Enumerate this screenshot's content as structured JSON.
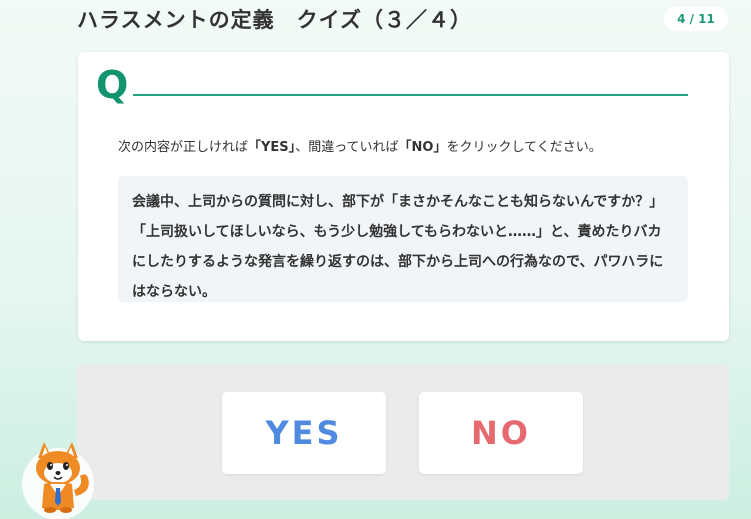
{
  "header": {
    "title": "ハラスメントの定義　クイズ（３／４）",
    "page_counter": "4 / 11"
  },
  "question": {
    "mark": "Q",
    "instruction": {
      "prefix": "次の内容が正しければ",
      "yes_word": "「YES」",
      "middle": "、間違っていれば",
      "no_word": "「NO」",
      "suffix": "をクリックしてください。"
    },
    "statement": "会議中、上司からの質問に対し、部下が「まさかそんなことも知らないんですか？」「上司扱いしてほしいなら、もう少し勉強してもらわないと……」と、責めたりバカにしたりするような発言を繰り返すのは、部下から上司への行為なので、パワハラにはならない。"
  },
  "answers": {
    "yes_label": "YES",
    "no_label": "NO"
  },
  "mascot": {
    "icon": "raccoon-mascot-icon"
  },
  "colors": {
    "accent": "#12946f",
    "yes": "#4f89e0",
    "no": "#e46a6f"
  }
}
